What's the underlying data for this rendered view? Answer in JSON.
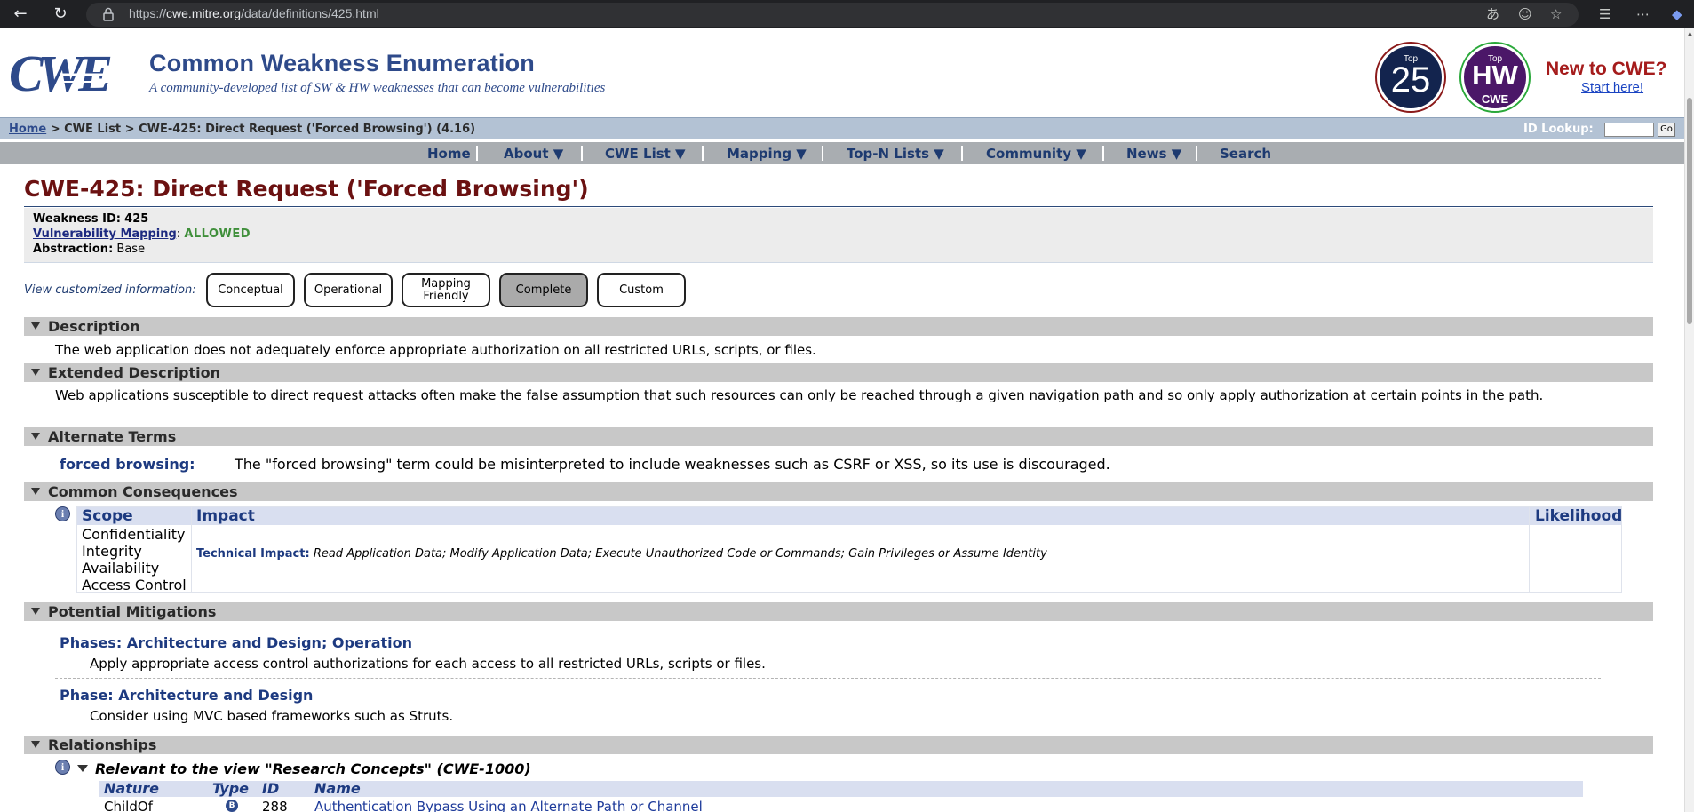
{
  "browser": {
    "url_prefix": "https://",
    "url_domain": "cwe.mitre.org",
    "url_path": "/data/definitions/425.html"
  },
  "header": {
    "logo_text": "CWE",
    "title": "Common Weakness Enumeration",
    "subtitle": "A community-developed list of SW & HW weaknesses that can become vulnerabilities",
    "badge_top25_top": "Top",
    "badge_top25_number": "25",
    "badge_hw_top": "Top",
    "badge_hw_big": "HW",
    "badge_hw_cwe": "CWE",
    "new_to_cwe": "New to CWE?",
    "start_here": "Start here!"
  },
  "breadcrumb": {
    "home": "Home",
    "sep1": " > ",
    "list": "CWE List",
    "sep2": " > ",
    "current": "CWE-425: Direct Request ('Forced Browsing') (4.16)",
    "id_lookup_label": "ID Lookup:",
    "go_label": "Go"
  },
  "menu": {
    "items": [
      {
        "label": "Home"
      },
      {
        "label": "About  ▼"
      },
      {
        "label": "CWE List  ▼"
      },
      {
        "label": "Mapping  ▼"
      },
      {
        "label": "Top-N Lists  ▼"
      },
      {
        "label": "Community  ▼"
      },
      {
        "label": "News  ▼"
      },
      {
        "label": "Search"
      }
    ]
  },
  "page": {
    "title": "CWE-425: Direct Request ('Forced Browsing')",
    "weakness_id_label": "Weakness ID:",
    "weakness_id": "425",
    "vuln_mapping_label": "Vulnerability Mapping",
    "vuln_mapping_value": "ALLOWED",
    "abstraction_label": "Abstraction:",
    "abstraction_value": "Base"
  },
  "views": {
    "label": "View customized information:",
    "buttons": [
      {
        "label": "Conceptual"
      },
      {
        "label": "Operational"
      },
      {
        "label": "Mapping Friendly"
      },
      {
        "label": "Complete",
        "active": true
      },
      {
        "label": "Custom"
      }
    ]
  },
  "sections": {
    "description": {
      "title": "Description",
      "text": "The web application does not adequately enforce appropriate authorization on all restricted URLs, scripts, or files."
    },
    "extended": {
      "title": "Extended Description",
      "text": "Web applications susceptible to direct request attacks often make the false assumption that such resources can only be reached through a given navigation path and so only apply authorization at certain points in the path."
    },
    "alternate": {
      "title": "Alternate Terms",
      "term": "forced browsing:",
      "desc": "The \"forced browsing\" term could be misinterpreted to include weaknesses such as CSRF or XSS, so its use is discouraged."
    },
    "consequences": {
      "title": "Common Consequences",
      "head_scope": "Scope",
      "head_impact": "Impact",
      "head_likelihood": "Likelihood",
      "scopes": [
        "Confidentiality",
        "Integrity",
        "Availability",
        "Access Control"
      ],
      "tech_impact_label": "Technical Impact:",
      "tech_impact": "Read Application Data; Modify Application Data; Execute Unauthorized Code or Commands; Gain Privileges or Assume Identity"
    },
    "mitigations": {
      "title": "Potential Mitigations",
      "phase1_title": "Phases: Architecture and Design; Operation",
      "phase1_text": "Apply appropriate access control authorizations for each access to all restricted URLs, scripts or files.",
      "phase2_title": "Phase: Architecture and Design",
      "phase2_text": "Consider using MVC based frameworks such as Struts."
    },
    "relationships": {
      "title": "Relationships",
      "view_title": "Relevant to the view \"Research Concepts\" (CWE-1000)",
      "head_nature": "Nature",
      "head_type": "Type",
      "head_id": "ID",
      "head_name": "Name",
      "row_nature": "ChildOf",
      "row_type_icon": "B",
      "row_id": "288",
      "row_name": "Authentication Bypass Using an Alternate Path or Channel"
    }
  },
  "colors": {
    "title_red": "#6b1111",
    "link_blue": "#1d3a80",
    "allowed_green": "#3f8f3a",
    "section_gray": "#c8c8c8"
  }
}
